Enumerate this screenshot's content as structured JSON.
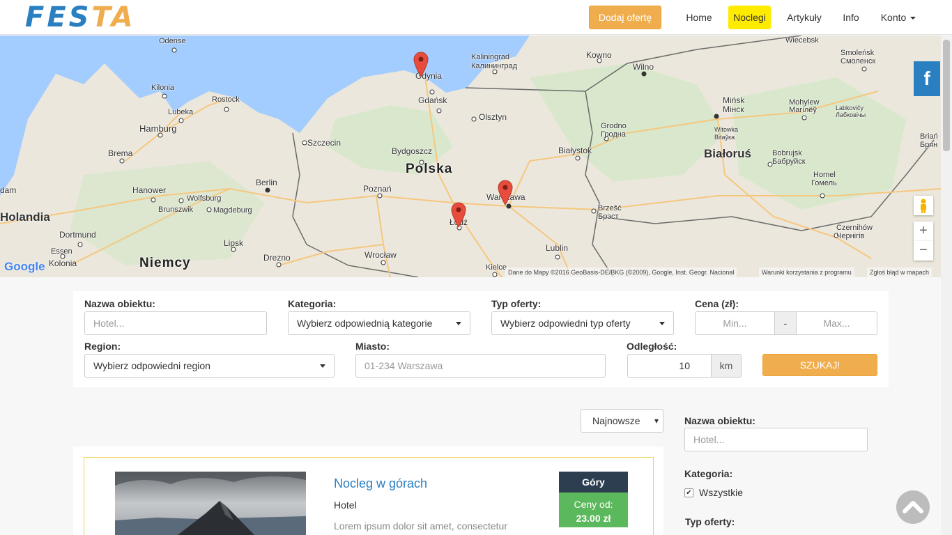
{
  "header": {
    "logo_part1": "FES",
    "logo_part2": "TA",
    "add_offer_label": "Dodaj ofertę",
    "nav": [
      {
        "label": "Home"
      },
      {
        "label": "Noclegi",
        "active": true
      },
      {
        "label": "Artykuły"
      },
      {
        "label": "Info"
      },
      {
        "label": "Konto"
      }
    ]
  },
  "map": {
    "labels": {
      "odense": "Odense",
      "kiel": "Kilonia",
      "rostock": "Rostock",
      "lubeka": "Lubeka",
      "hamburg": "Hamburg",
      "brema": "Brema",
      "hanower": "Hanower",
      "wolfsburg": "Wolfsburg",
      "brunszwik": "Brunszwik",
      "magdeburg": "Magdeburg",
      "berlin": "Berlin",
      "dortmund": "Dortmund",
      "essen": "Essen",
      "kolonia": "Kolonia",
      "lipsk": "Lipsk",
      "drezno": "Drezno",
      "niemcy": "Niemcy",
      "holandia": "Holandia",
      "amsterdam": "dam",
      "szczecin": "Szczecin",
      "gdynia": "Gdynia",
      "gdansk": "Gdańsk",
      "kaliningrad1": "Kaliningrad",
      "kaliningrad2": "Калининград",
      "olsztyn": "Olsztyn",
      "bydgoszcz": "Bydgoszcz",
      "polska": "Polska",
      "poznan": "Poznań",
      "warszawa": "Warszawa",
      "lodz": "Łódź",
      "wroclaw": "Wrocław",
      "lublin": "Lublin",
      "kielce": "Kielce",
      "bialystok": "Białystok",
      "grodno1": "Grodno",
      "grodno2": "Гродна",
      "brzesc1": "Brzešć",
      "brzesc2": "Брэст",
      "kowno": "Kowno",
      "wilno": "Wilno",
      "minsk1": "Mińsk",
      "minsk2": "Мінск",
      "bialorus": "Białoruś",
      "bobrujsk1": "Bobrujsk",
      "bobrujsk2": "Бабруйск",
      "mohylew1": "Mohylew",
      "mohylew2": "Магілёў",
      "witebsk1": "Witowka",
      "witebsk2": "Віtаўка",
      "homel1": "Homel",
      "homel2": "Гомель",
      "czernihow1": "Czernihów",
      "czernihow2": "Чернігів",
      "wiecebsk": "Wiecebsk",
      "smolensk1": "Smoleńsk",
      "smolensk2": "Смоленск",
      "labkovicy1": "Labkovičy",
      "labkovicy2": "Лабковічы",
      "briansk1": "Briań",
      "briansk2": "Брян"
    },
    "google_logo": "Google",
    "footer": {
      "data": "Dane do Mapy ©2016 GeoBasis-DE/BKG (©2009), Google, Inst. Geogr. Nacional",
      "terms": "Warunki korzystania z programu",
      "report": "Zgłoś błąd w mapach"
    },
    "fb_label": "f",
    "zoom_in": "+",
    "zoom_out": "−",
    "colors": {
      "water": "#a3ccff",
      "land": "#ece7dc",
      "green": "#cde6c0",
      "road": "#f5c77e",
      "pin": "#e74c3c"
    }
  },
  "search": {
    "name_label": "Nazwa obiektu:",
    "name_placeholder": "Hotel...",
    "category_label": "Kategoria:",
    "category_value": "Wybierz odpowiednią kategorie",
    "offer_type_label": "Typ oferty:",
    "offer_type_value": "Wybierz odpowiedni typ oferty",
    "price_label": "Cena (zł):",
    "price_min_placeholder": "Min...",
    "price_sep": "-",
    "price_max_placeholder": "Max...",
    "region_label": "Region:",
    "region_value": "Wybierz odpowiedni region",
    "city_label": "Miasto:",
    "city_placeholder": "01-234 Warszawa",
    "distance_label": "Odległość:",
    "distance_value": "10",
    "distance_unit": "km",
    "search_button": "SZUKAJ!"
  },
  "results": {
    "sort_value": "Najnowsze",
    "items": [
      {
        "title": "Nocleg w górach",
        "type": "Hotel",
        "description": "Lorem ipsum dolor sit amet, consectetur",
        "category": "Góry",
        "price_prefix": "Ceny od:",
        "price": "23.00 zł"
      }
    ]
  },
  "sidebar": {
    "name_label": "Nazwa obiektu:",
    "name_placeholder": "Hotel...",
    "category_label": "Kategoria:",
    "all_label": "Wszystkie",
    "all_checked": true,
    "offer_type_label": "Typ oferty:"
  }
}
